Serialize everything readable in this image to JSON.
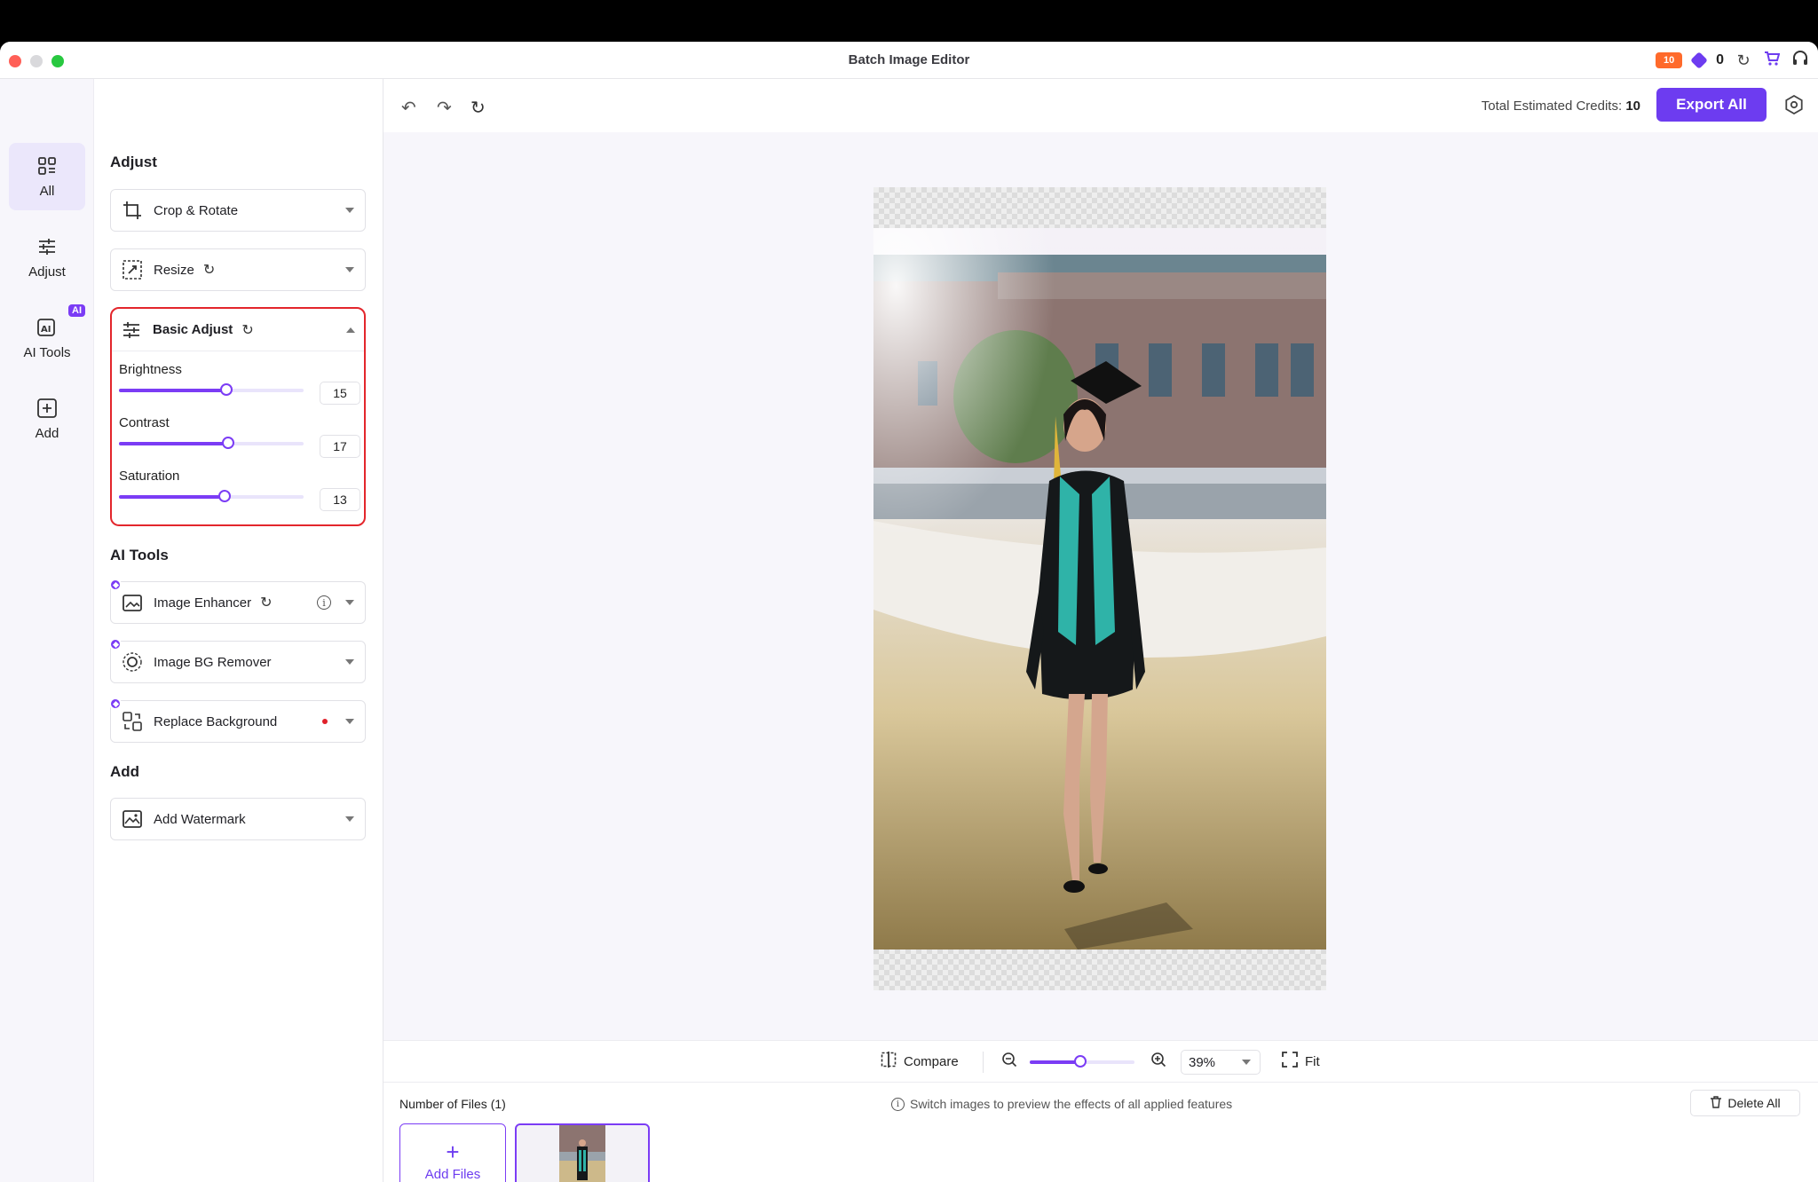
{
  "window": {
    "title": "Batch Image Editor"
  },
  "titlebar": {
    "coupon_label": "10",
    "credits": "0"
  },
  "rail": {
    "items": [
      {
        "label": "All",
        "icon": "grid-icon",
        "active": true
      },
      {
        "label": "Adjust",
        "icon": "sliders-icon",
        "active": false
      },
      {
        "label": "AI Tools",
        "icon": "ai-icon",
        "active": false,
        "badge": "AI"
      },
      {
        "label": "Add",
        "icon": "add-square-icon",
        "active": false
      }
    ]
  },
  "panel": {
    "adjust_title": "Adjust",
    "crop_label": "Crop & Rotate",
    "resize_label": "Resize",
    "basic_adjust": {
      "label": "Basic Adjust",
      "sliders": [
        {
          "label": "Brightness",
          "value": "15",
          "fraction": 0.58
        },
        {
          "label": "Contrast",
          "value": "17",
          "fraction": 0.59
        },
        {
          "label": "Saturation",
          "value": "13",
          "fraction": 0.57
        }
      ]
    },
    "ai_title": "AI Tools",
    "enhancer_label": "Image Enhancer",
    "bg_remover_label": "Image BG Remover",
    "replace_bg_label": "Replace Background",
    "add_title": "Add",
    "watermark_label": "Add Watermark"
  },
  "toolbar": {
    "credits_label": "Total Estimated Credits:",
    "credits_value": "10",
    "export_label": "Export All"
  },
  "zoom": {
    "compare_label": "Compare",
    "zoom_value": "39%",
    "zoom_fraction": 0.39,
    "fit_label": "Fit"
  },
  "files": {
    "count_label": "Number of Files (1)",
    "hint": "Switch images to preview the effects of all applied features",
    "delete_label": "Delete All",
    "add_label": "Add Files",
    "add_plus": "+"
  },
  "colors": {
    "accent": "#6d3cf0",
    "highlight_border": "#e3262c"
  }
}
